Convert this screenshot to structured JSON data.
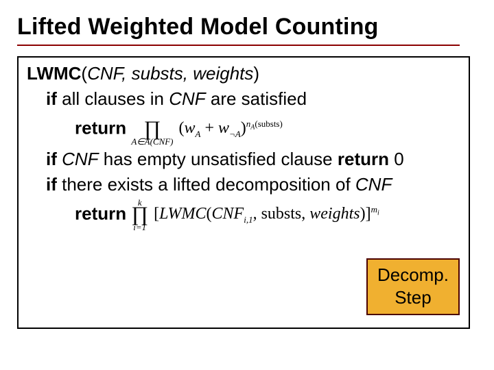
{
  "title": "Lifted Weighted Model Counting",
  "algo": {
    "name": "LWMC",
    "args_open": "(",
    "args": "CNF, substs, weights",
    "args_close": ")",
    "line1_if": "if",
    "line1_rest_a": " all clauses in ",
    "line1_cnf": "CNF",
    "line1_rest_b": " are satisfied",
    "return": "return",
    "line3_if": "if",
    "line3_a": " ",
    "line3_cnf": "CNF",
    "line3_b": " has empty unsatisfied clause ",
    "line3_return": "return",
    "line3_zero": " 0",
    "line4_if": "if",
    "line4_a": " there exists a lifted decomposition of ",
    "line4_cnf": "CNF"
  },
  "math1": {
    "prod": "∏",
    "sub": "A∈A(CNF)",
    "open": "(",
    "wA": "w",
    "wA_sub": "A",
    "plus": " + ",
    "wnA": "w",
    "wnA_sub": "¬A",
    "close": ")",
    "exp_n": "n",
    "exp_sub": "A",
    "exp_paren": "(substs)"
  },
  "math2": {
    "prod": "∏",
    "sup": "k",
    "sub": "i=1",
    "open": "[",
    "fn": "LWMC",
    "fn_open": "(",
    "arg1": "CNF",
    "arg1_sub": "i,1",
    "comma": ", ",
    "arg2": "substs",
    "comma2": ", ",
    "arg3": "weights",
    "fn_close": ")",
    "close": "]",
    "exp_m": "m",
    "exp_sub": "i"
  },
  "box": {
    "l1": "Decomp.",
    "l2": "Step"
  }
}
